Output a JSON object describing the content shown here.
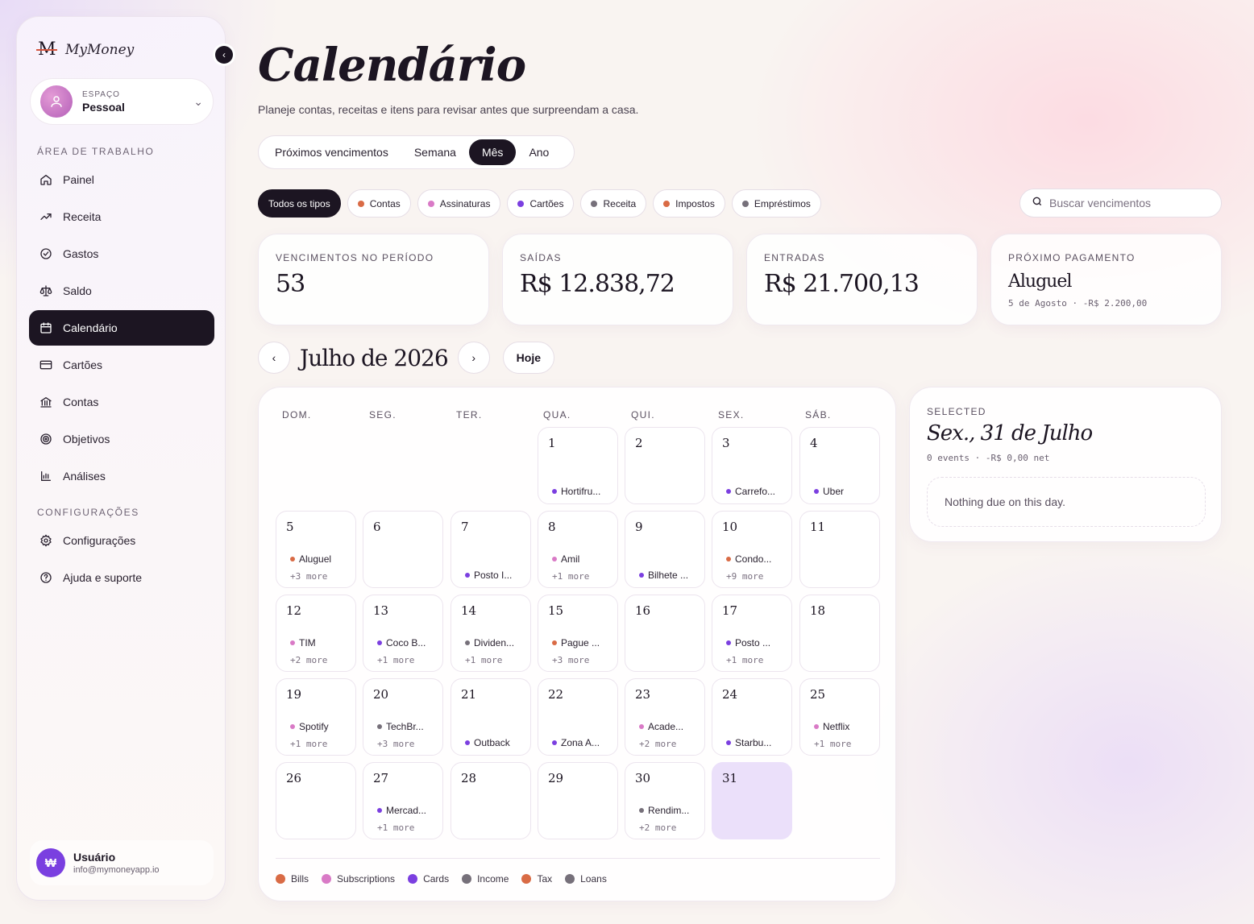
{
  "brand": {
    "mark": "M",
    "name": "MyMoney"
  },
  "space": {
    "label": "ESPAÇO",
    "name": "Pessoal"
  },
  "nav": {
    "section_work": "ÁREA DE TRABALHO",
    "section_config": "CONFIGURAÇÕES",
    "items": [
      {
        "label": "Painel",
        "icon": "home-icon"
      },
      {
        "label": "Receita",
        "icon": "trend-up-icon"
      },
      {
        "label": "Gastos",
        "icon": "check-circle-icon"
      },
      {
        "label": "Saldo",
        "icon": "scale-icon"
      },
      {
        "label": "Calendário",
        "icon": "calendar-icon",
        "active": true
      },
      {
        "label": "Cartões",
        "icon": "card-icon"
      },
      {
        "label": "Contas",
        "icon": "bank-icon"
      },
      {
        "label": "Objetivos",
        "icon": "target-icon"
      },
      {
        "label": "Análises",
        "icon": "bar-chart-icon"
      }
    ],
    "config_items": [
      {
        "label": "Configurações",
        "icon": "gear-icon"
      },
      {
        "label": "Ajuda e suporte",
        "icon": "help-icon"
      }
    ]
  },
  "user": {
    "initials": "₩",
    "name": "Usuário",
    "email": "info@mymoneyapp.io"
  },
  "page": {
    "title": "Calendário",
    "subtitle": "Planeje contas, receitas e itens para revisar antes que surpreendam a casa."
  },
  "view_tabs": [
    "Próximos vencimentos",
    "Semana",
    "Mês",
    "Ano"
  ],
  "active_view": "Mês",
  "filters": [
    {
      "label": "Todos os tipos",
      "active": true
    },
    {
      "label": "Contas",
      "color": "#d96b45"
    },
    {
      "label": "Assinaturas",
      "color": "#d97ac6"
    },
    {
      "label": "Cartões",
      "color": "#7b3fe0"
    },
    {
      "label": "Receita",
      "color": "#76707a"
    },
    {
      "label": "Impostos",
      "color": "#d96b45"
    },
    {
      "label": "Empréstimos",
      "color": "#76707a"
    }
  ],
  "search": {
    "placeholder": "Buscar vencimentos"
  },
  "stats": {
    "due": {
      "label": "VENCIMENTOS NO PERÍODO",
      "value": "53"
    },
    "out": {
      "label": "SAÍDAS",
      "value": "R$ 12.838,72"
    },
    "in": {
      "label": "ENTRADAS",
      "value": "R$ 21.700,13"
    },
    "next": {
      "label": "PRÓXIMO PAGAMENTO",
      "value": "Aluguel",
      "sub": "5 de Agosto · -R$ 2.200,00"
    }
  },
  "month": {
    "title": "Julho de 2026",
    "today_label": "Hoje"
  },
  "weekdays": [
    "DOM.",
    "SEG.",
    "TER.",
    "QUA.",
    "QUI.",
    "SEX.",
    "SÁB."
  ],
  "first_weekday": 3,
  "selected_day": 31,
  "days": [
    {
      "n": "1",
      "event": "Hortifru...",
      "color": "#7b3fe0"
    },
    {
      "n": "2"
    },
    {
      "n": "3",
      "event": "Carrefo...",
      "color": "#7b3fe0"
    },
    {
      "n": "4",
      "event": "Uber",
      "color": "#7b3fe0"
    },
    {
      "n": "5",
      "event": "Aluguel",
      "color": "#d96b45",
      "more": "+3 more"
    },
    {
      "n": "6"
    },
    {
      "n": "7",
      "event": "Posto I...",
      "color": "#7b3fe0"
    },
    {
      "n": "8",
      "event": "Amil",
      "color": "#d97ac6",
      "more": "+1 more"
    },
    {
      "n": "9",
      "event": "Bilhete ...",
      "color": "#7b3fe0"
    },
    {
      "n": "10",
      "event": "Condo...",
      "color": "#d96b45",
      "more": "+9 more"
    },
    {
      "n": "11"
    },
    {
      "n": "12",
      "event": "TIM",
      "color": "#d97ac6",
      "more": "+2 more"
    },
    {
      "n": "13",
      "event": "Coco B...",
      "color": "#7b3fe0",
      "more": "+1 more"
    },
    {
      "n": "14",
      "event": "Dividen...",
      "color": "#76707a",
      "more": "+1 more"
    },
    {
      "n": "15",
      "event": "Pague ...",
      "color": "#d96b45",
      "more": "+3 more"
    },
    {
      "n": "16"
    },
    {
      "n": "17",
      "event": "Posto ...",
      "color": "#7b3fe0",
      "more": "+1 more"
    },
    {
      "n": "18"
    },
    {
      "n": "19",
      "event": "Spotify",
      "color": "#d97ac6",
      "more": "+1 more"
    },
    {
      "n": "20",
      "event": "TechBr...",
      "color": "#76707a",
      "more": "+3 more"
    },
    {
      "n": "21",
      "event": "Outback",
      "color": "#7b3fe0"
    },
    {
      "n": "22",
      "event": "Zona A...",
      "color": "#7b3fe0"
    },
    {
      "n": "23",
      "event": "Acade...",
      "color": "#d97ac6",
      "more": "+2 more"
    },
    {
      "n": "24",
      "event": "Starbu...",
      "color": "#7b3fe0"
    },
    {
      "n": "25",
      "event": "Netflix",
      "color": "#d97ac6",
      "more": "+1 more"
    },
    {
      "n": "26"
    },
    {
      "n": "27",
      "event": "Mercad...",
      "color": "#7b3fe0",
      "more": "+1 more"
    },
    {
      "n": "28"
    },
    {
      "n": "29"
    },
    {
      "n": "30",
      "event": "Rendim...",
      "color": "#76707a",
      "more": "+2 more"
    },
    {
      "n": "31"
    }
  ],
  "legend": [
    {
      "label": "Bills",
      "color": "#d96b45"
    },
    {
      "label": "Subscriptions",
      "color": "#d97ac6"
    },
    {
      "label": "Cards",
      "color": "#7b3fe0"
    },
    {
      "label": "Income",
      "color": "#76707a"
    },
    {
      "label": "Tax",
      "color": "#d96b45"
    },
    {
      "label": "Loans",
      "color": "#76707a"
    }
  ],
  "detail": {
    "label": "SELECTED",
    "title": "Sex., 31 de Julho",
    "sub": "0 events · -R$ 0,00 net",
    "empty": "Nothing due on this day."
  }
}
